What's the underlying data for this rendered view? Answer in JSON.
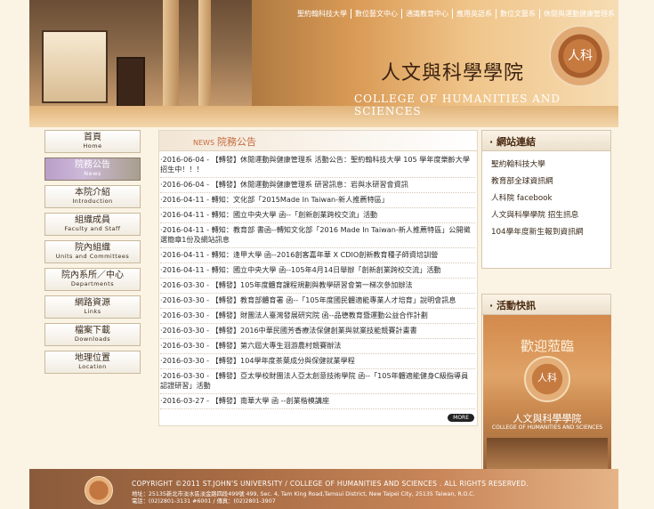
{
  "top_nav": [
    "聖約翰科技大學",
    "數位藝文中心",
    "通識教育中心",
    "應用英語系",
    "數位文藝系",
    "休閒與運動健康管理系"
  ],
  "college": {
    "name_zh": "人文與科學學院",
    "name_en": "COLLEGE OF HUMANITIES AND SCIENCES",
    "seal_text": "人科"
  },
  "left_nav": [
    {
      "zh": "首頁",
      "en": "Home"
    },
    {
      "zh": "院務公告",
      "en": "News",
      "active": true
    },
    {
      "zh": "本院介紹",
      "en": "Introduction"
    },
    {
      "zh": "組織成員",
      "en": "Faculty and Staff"
    },
    {
      "zh": "院內組織",
      "en": "Units and Committees"
    },
    {
      "zh": "院內系所／中心",
      "en": "Departments"
    },
    {
      "zh": "網路資源",
      "en": "Links"
    },
    {
      "zh": "檔案下載",
      "en": "Downloads"
    },
    {
      "zh": "地理位置",
      "en": "Location"
    }
  ],
  "news": {
    "header_en": "NEWS",
    "header_zh": "院務公告",
    "more_label": "MORE",
    "items": [
      "·2016-06-04 - 【轉發】休閒運動與健康管理系 活動公告：聖約翰科技大學 105 學年度樂齡大學招生中！！！",
      "·2016-06-04 - 【轉發】休閒運動與健康管理系 研習訊息：岩與水研習會資訊",
      "·2016-04-11 - 轉知：文化部「2015Made In Taiwan-新人推薦特區」",
      "·2016-04-11 - 轉知：國立中央大學 函--「創新創業跨校交流」活動",
      "·2016-04-11 - 轉知：教育部 書函--轉知文化部「2016 Made In Taiwan-新人推薦特區」公開徵選簡章1份及網站訊息",
      "·2016-04-11 - 轉知：逢甲大學 函--2016創客嘉年華 X CDIO創新教育種子師資培訓營",
      "·2016-04-11 - 轉知：國立中央大學 函--105年4月14日舉辦「創新創業跨校交流」活動",
      "·2016-03-30 - 【轉發】105年度體育課程規劃與教學研習會第一梯次參加辦法",
      "·2016-03-30 - 【轉發】教育部體育署 函--「105年度國民體適能專業人才培育」說明會訊息",
      "·2016-03-30 - 【轉發】財團法人臺灣發展研究院 函--品德教育暨運動公益合作計劃",
      "·2016-03-30 - 【轉發】2016中華民國芳香療法保健創業與就業技能競賽計畫書",
      "·2016-03-30 - 【轉發】第六屆大專生洄游農村競賽辦法",
      "·2016-03-30 - 【轉發】104學年度茶葉成分與保健就業學程",
      "·2016-03-30 - 【轉發】亞太學校財團法人亞太創意技術學院 函--「105年體適能健身C級指導員認證研習」活動",
      "·2016-03-27 - 【轉發】南華大學 函 --創業楷模講座"
    ]
  },
  "sidebar": {
    "links_title": "· 網站連結",
    "links": [
      "聖約翰科技大學",
      "教育部全球資訊網",
      "人科院 facebook",
      "人文與科學學院 招生訊息",
      "104學年度新生報到資訊網"
    ],
    "activity_title": "· 活動快訊",
    "activity": {
      "welcome": "歡迎蒞臨",
      "seal": "人科",
      "name_zh": "人文與科學學院",
      "name_en": "COLLEGE OF HUMANITIES AND SCIENCES"
    }
  },
  "footer": {
    "seal": "St",
    "copyright": "COPYRIGHT ©2011 ST.JOHN'S UNIVERSITY / COLLEGE OF HUMANITIES AND SCIENCES . ALL RIGHTS RESERVED.",
    "address": "地址：25135新北市淡水區淡金路四段499號   499, Sec. 4, Tam King Road,Tamsui District, New Taipei City, 25135 Taiwan, R.O.C.",
    "phone": "電話：(02)2801-3131 #6001 / 傳真：(02)2801-3907"
  },
  "colors": {
    "accent": "#c56a3f",
    "background": "#fbf3e4",
    "banner": "#d99a55"
  }
}
